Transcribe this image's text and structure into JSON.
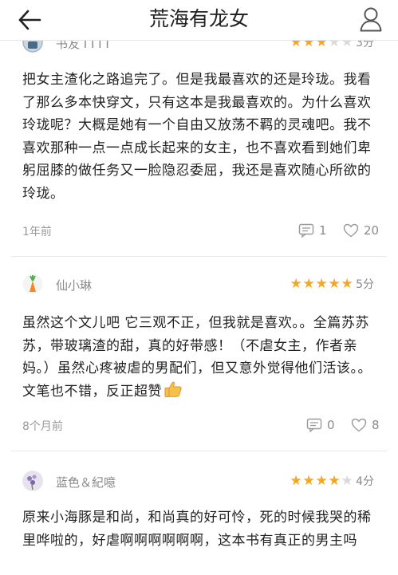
{
  "header": {
    "title": "荒海有龙女"
  },
  "reviews": [
    {
      "user": "书友 I I I I",
      "stars": 3,
      "score": "3分",
      "text": "把女主渣化之路追完了。但是我最喜欢的还是玲珑。我看了那么多本快穿文，只有这本是我最喜欢的。为什么喜欢玲珑呢？大概是她有一个自由又放荡不羁的灵魂吧。我不喜欢那种一点一点成长起来的女主，也不喜欢看到她们卑躬屈膝的做任务又一脸隐忍委屈，我还是喜欢随心所欲的玲珑。",
      "time": "1年前",
      "comments": "1",
      "likes": "20"
    },
    {
      "user": "仙小琳",
      "stars": 5,
      "score": "5分",
      "text": "虽然这个文儿吧 它三观不正，但我就是喜欢。。全篇苏苏苏，带玻璃渣的甜，真的好带感！（不虐女主，作者亲妈。）虽然心疼被虐的男配们，但又意外觉得他们活该。。文笔也不错，反正超赞",
      "time": "8个月前",
      "comments": "0",
      "likes": "8"
    },
    {
      "user": "蓝色＆紀噫",
      "stars": 4,
      "score": "4分",
      "text": "原来小海豚是和尚，和尚真的好可怜，死的时候我哭的稀里哗啦的，好虐啊啊啊啊啊啊，这本书有真正的男主吗"
    }
  ],
  "colors": {
    "star": "#f5a623",
    "star_empty": "#d9d9d9",
    "meta": "#8a8a8a"
  },
  "icons": [
    "back-arrow-icon",
    "user-profile-icon",
    "star-icon",
    "comment-icon",
    "heart-icon",
    "thumbs-up-emoji"
  ]
}
